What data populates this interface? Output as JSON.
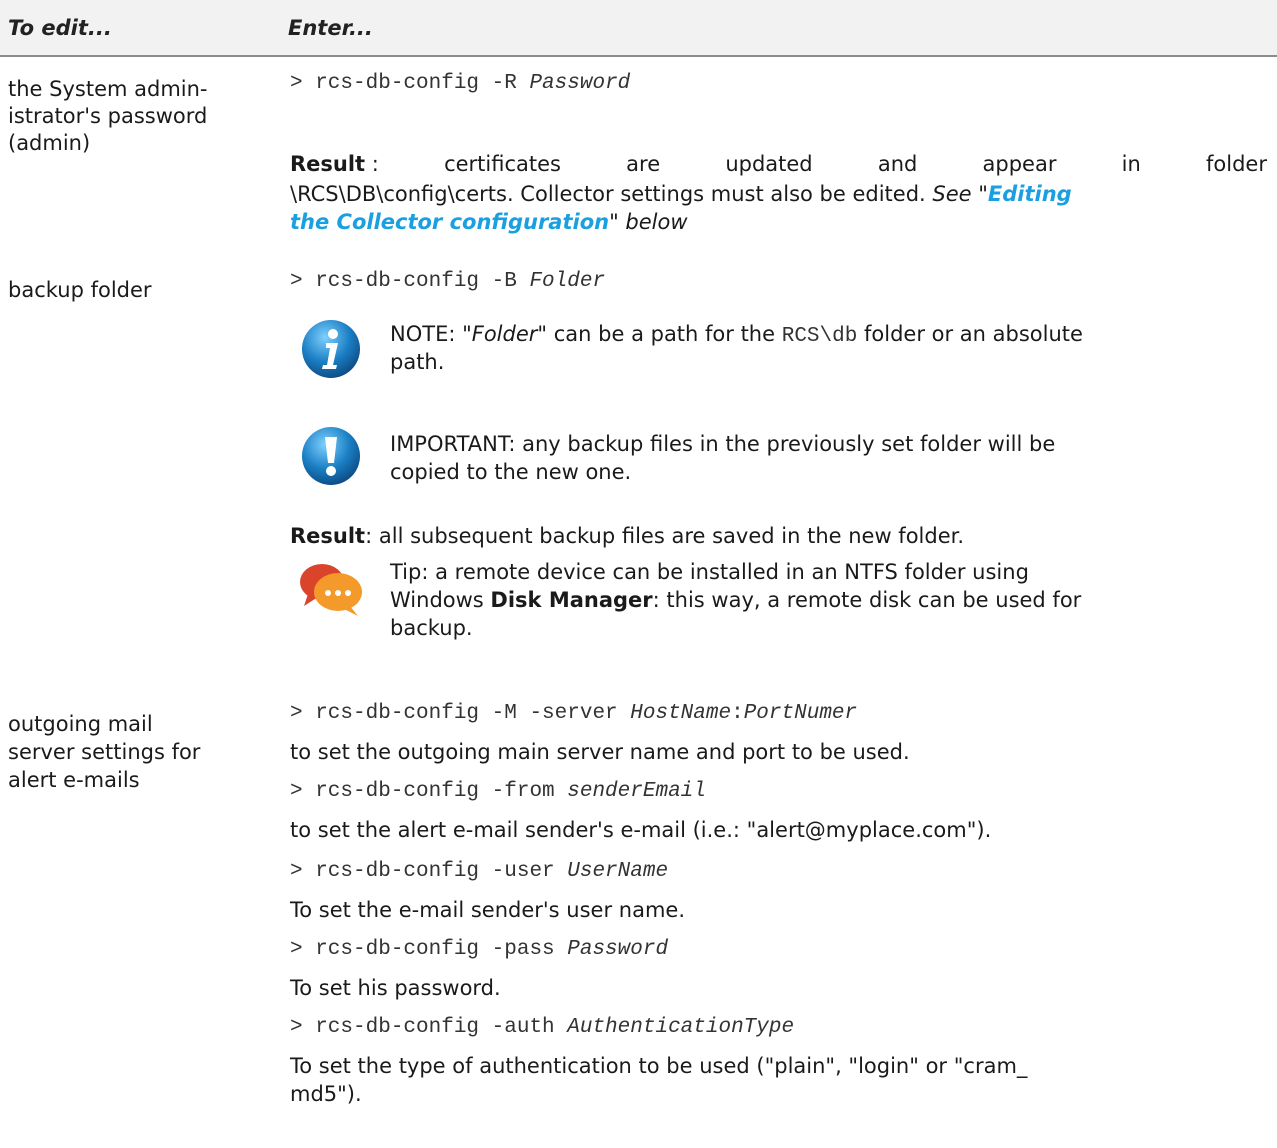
{
  "header": {
    "col1": "To edit...",
    "col2": "Enter..."
  },
  "rows": {
    "admin": {
      "label": [
        "the System admin-",
        "istrator's password",
        "(admin)"
      ],
      "cmd": {
        "prefix": "> rcs-db-config -R ",
        "arg": "Password"
      },
      "result": {
        "label": "Result",
        "line1_sep": " :",
        "line1_words": [
          "certificates",
          "are",
          "updated",
          "and",
          "appear",
          "in",
          "folder"
        ],
        "line2_text": "\\RCS\\DB\\config\\certs. Collector settings must also be edited.",
        "see_prefix": "See \"",
        "link_part1": "Editing",
        "link_part2": "the Collector configuration",
        "see_suffix": "\" below"
      }
    },
    "backup": {
      "label": "backup folder",
      "cmd": {
        "prefix": "> rcs-db-config -B ",
        "arg": "Folder"
      },
      "note": {
        "icon": "info-icon",
        "prefix": "NOTE: \"",
        "em": "Folder",
        "mid": "\" can be a path for the ",
        "code": "RCS\\db",
        "suffix": " folder or an absolute",
        "line2": "path."
      },
      "important": {
        "icon": "exclamation-icon",
        "line1": "IMPORTANT: any backup files in the previously set folder will be",
        "line2": "copied to the new one."
      },
      "result": {
        "label": "Result",
        "text": ": all subsequent backup files are saved in the new folder."
      },
      "tip": {
        "icon": "chat-bubbles-icon",
        "line1": "Tip: a remote device can be installed in an NTFS folder using",
        "line2_prefix": "Windows ",
        "line2_bold": "Disk Manager",
        "line2_suffix": ": this way, a remote disk can be used for",
        "line3": "backup."
      }
    },
    "mail": {
      "label": [
        "outgoing mail",
        "server settings for",
        "alert e-mails"
      ],
      "cmd1": {
        "prefix": "> rcs-db-config -M -server ",
        "arg1": "HostName",
        "sep": ":",
        "arg2": "PortNumer"
      },
      "desc1": "to set the outgoing main server name and port to be used.",
      "cmd2": {
        "prefix": "> rcs-db-config -from ",
        "arg": "senderEmail"
      },
      "desc2": "to set the alert e-mail sender's e-mail (i.e.: \"alert@myplace.com\").",
      "cmd3": {
        "prefix": "> rcs-db-config -user ",
        "arg": "UserName"
      },
      "desc3": "To set the e-mail sender's user name.",
      "cmd4": {
        "prefix": "> rcs-db-config -pass ",
        "arg": "Password"
      },
      "desc4": "To set his password.",
      "cmd5": {
        "prefix": "> rcs-db-config -auth ",
        "arg": "AuthenticationType"
      },
      "desc5_line1": "To set the type of authentication to be used (\"plain\", \"login\" or \"cram_",
      "desc5_line2": "md5\")."
    }
  },
  "colors": {
    "link": "#1aa0e0",
    "header_bg": "#f2f2f2",
    "rule": "#8c8c8c",
    "info_icon": "#1b7fc4",
    "tip_orange": "#f39a2b",
    "tip_red": "#d9442b"
  }
}
